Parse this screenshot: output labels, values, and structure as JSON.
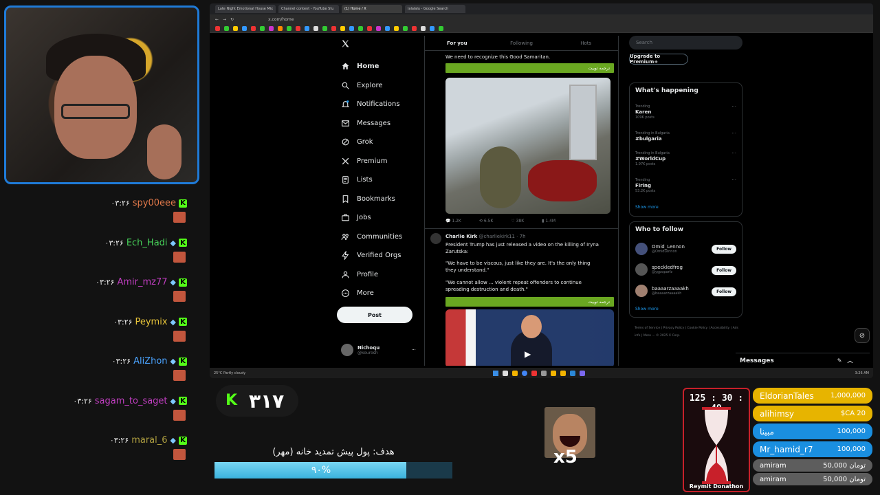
{
  "browser": {
    "tabs": [
      "Late Night Emotional House Mix",
      "Channel content - YouTube Stu",
      "(1) Home / X",
      "lalalalu - Google Search"
    ],
    "url": "x.com/home"
  },
  "x": {
    "nav": [
      "Home",
      "Explore",
      "Notifications",
      "Messages",
      "Grok",
      "Premium",
      "Lists",
      "Bookmarks",
      "Jobs",
      "Communities",
      "Verified Orgs",
      "Profile",
      "More"
    ],
    "post_label": "Post",
    "profile_name": "Nichoqu",
    "profile_handle": "@kourosh",
    "feed_tabs": [
      "For you",
      "Following",
      "Hots"
    ],
    "tweet1_text": "We need to recognize this Good Samaritan.",
    "translate_label": "ترجمه توییت",
    "tweet1_stats": [
      "1.2K",
      "6.5K",
      "38K",
      "1.4M"
    ],
    "tweet2_author": "Charlie Kirk",
    "tweet2_handle": "@charliekirk11 · 7h",
    "tweet2_line1": "President Trump has just released a video on the killing of Iryna Zarutska:",
    "tweet2_line2": "\"We have to be viscous, just like they are. It's the only thing they understand.\"",
    "tweet2_line3": "\"We cannot allow ... violent repeat offenders to continue spreading destruction and death.\"",
    "search_placeholder": "Search",
    "upgrade_label": "Upgrade to Premium+",
    "whats_happening": "What's happening",
    "trends": [
      {
        "meta": "Trending",
        "name": "Karen",
        "count": "109K posts"
      },
      {
        "meta": "Trending in Bulgaria",
        "name": "#bulgaria",
        "count": ""
      },
      {
        "meta": "Trending in Bulgaria",
        "name": "#WorldCup",
        "count": "1.97K posts"
      },
      {
        "meta": "Trending",
        "name": "Firing",
        "count": "53.2K posts"
      }
    ],
    "show_more": "Show more",
    "who_to_follow": "Who to follow",
    "follows": [
      {
        "name": "Omid_Lennon",
        "handle": "@OmidLennon"
      },
      {
        "name": "speckledfrog",
        "handle": "@ygpoparfz"
      },
      {
        "name": "baaaarzaaaakh",
        "handle": "@baaaarzaaaakh"
      }
    ],
    "follow_label": "Follow",
    "footer": "Terms of Service | Privacy Policy | Cookie Policy | Accessibility | Ads info | More ··· © 2025 X Corp.",
    "messages_label": "Messages"
  },
  "taskbar": {
    "weather": "25°C Partly cloudy",
    "clock": "3:26 AM"
  },
  "chat": [
    {
      "user": "spy00eee",
      "time": "۰۳:۲۶",
      "color": "#e2794a"
    },
    {
      "user": "Ech_Hadi",
      "time": "۰۳:۲۶",
      "color": "#47d45a"
    },
    {
      "user": "Amir_mz77",
      "time": "۰۳:۲۶",
      "color": "#c13ec1"
    },
    {
      "user": "Peymix",
      "time": "۰۳:۲۶",
      "color": "#e8c53a"
    },
    {
      "user": "AliZhon",
      "time": "۰۳:۲۶",
      "color": "#4aa3ff"
    },
    {
      "user": "sagam_to_saget",
      "time": "۰۳:۲۶",
      "color": "#c13ec1"
    },
    {
      "user": "maral_6",
      "time": "۰۳:۲۶",
      "color": "#b0a040"
    }
  ],
  "stream": {
    "sub_count": "۳۱۷",
    "goal_label": "هدف: پول پیش تمدید خانه (مهر)",
    "goal_percent_text": "۹۰%",
    "goal_progress": 0.9,
    "multiplier": "x5",
    "timer": "125 : 30 : 49",
    "timer_title": "Reymit Donathon",
    "donations": [
      {
        "name": "EldorianTales",
        "amount": "1,000,000",
        "color": "#e7b400"
      },
      {
        "name": "alihimsy",
        "amount": "$CA 20",
        "color": "#e7b400"
      },
      {
        "name": "مبینا",
        "amount": "100,000",
        "color": "#1a8fe0"
      },
      {
        "name": "Mr_hamid_r7",
        "amount": "100,000",
        "color": "#1a8fe0"
      },
      {
        "name": "amiram",
        "amount": "50,000 تومان",
        "color": "#5d5d5d"
      },
      {
        "name": "amiram",
        "amount": "50,000 تومان",
        "color": "#5d5d5d"
      }
    ]
  }
}
